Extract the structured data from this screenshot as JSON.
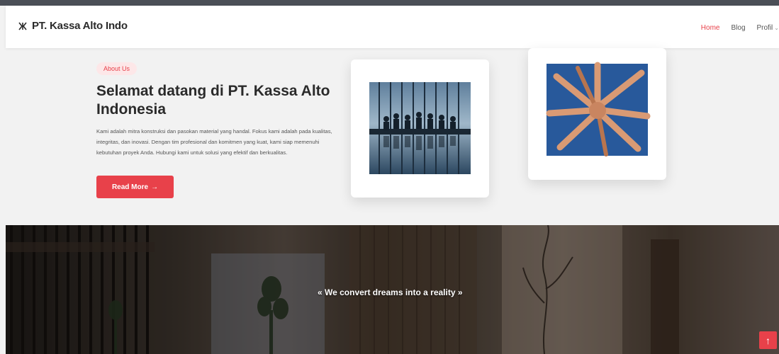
{
  "header": {
    "brand": "PT. Kassa Alto Indo",
    "nav": [
      {
        "label": "Home"
      },
      {
        "label": "Blog"
      },
      {
        "label": "Profil"
      }
    ]
  },
  "hero": {
    "pill_label": "About Us",
    "title": "Selamat datang di PT. Kassa Alto Indonesia",
    "description": "Kami adalah mitra konstruksi dan pasokan material yang handal. Fokus kami adalah pada kualitas, integritas, dan inovasi. Dengan tim profesional dan komitmen yang kuat, kami siap memenuhi kebutuhan proyek Anda. Hubungi kami untuk solusi yang efektif dan berkualitas.",
    "button_label": "Read More",
    "button_icon": "arrow-right-icon"
  },
  "banner": {
    "tagline": "« We convert dreams into a reality »"
  },
  "colors": {
    "accent": "#e8414a",
    "pill_bg": "#fde7e8",
    "text_dark": "#2a2a2a"
  }
}
